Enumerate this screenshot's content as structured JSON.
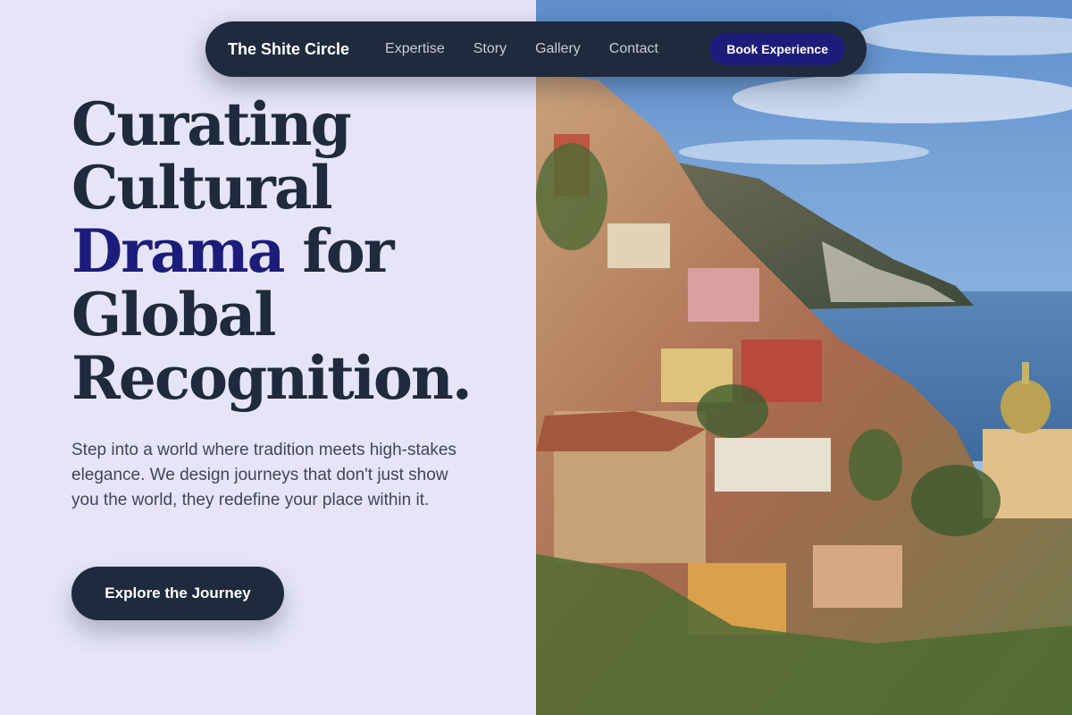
{
  "nav": {
    "brand": "The Shite Circle",
    "links": [
      "Expertise",
      "Story",
      "Gallery",
      "Contact"
    ],
    "cta": "Book Experience"
  },
  "hero": {
    "headline": {
      "line1": "Curating",
      "line2": "Cultural",
      "accent": "Drama",
      "line3_rest": " for",
      "line4": "Global",
      "line5": "Recognition."
    },
    "subtext": "Step into a world where tradition meets high-stakes elegance. We design journeys that don't just show you the world, they redefine your place within it.",
    "cta": "Explore the Journey"
  },
  "colors": {
    "background": "#e6e5f8",
    "primary": "#1f2a3c",
    "accent": "#1c1d7a"
  }
}
